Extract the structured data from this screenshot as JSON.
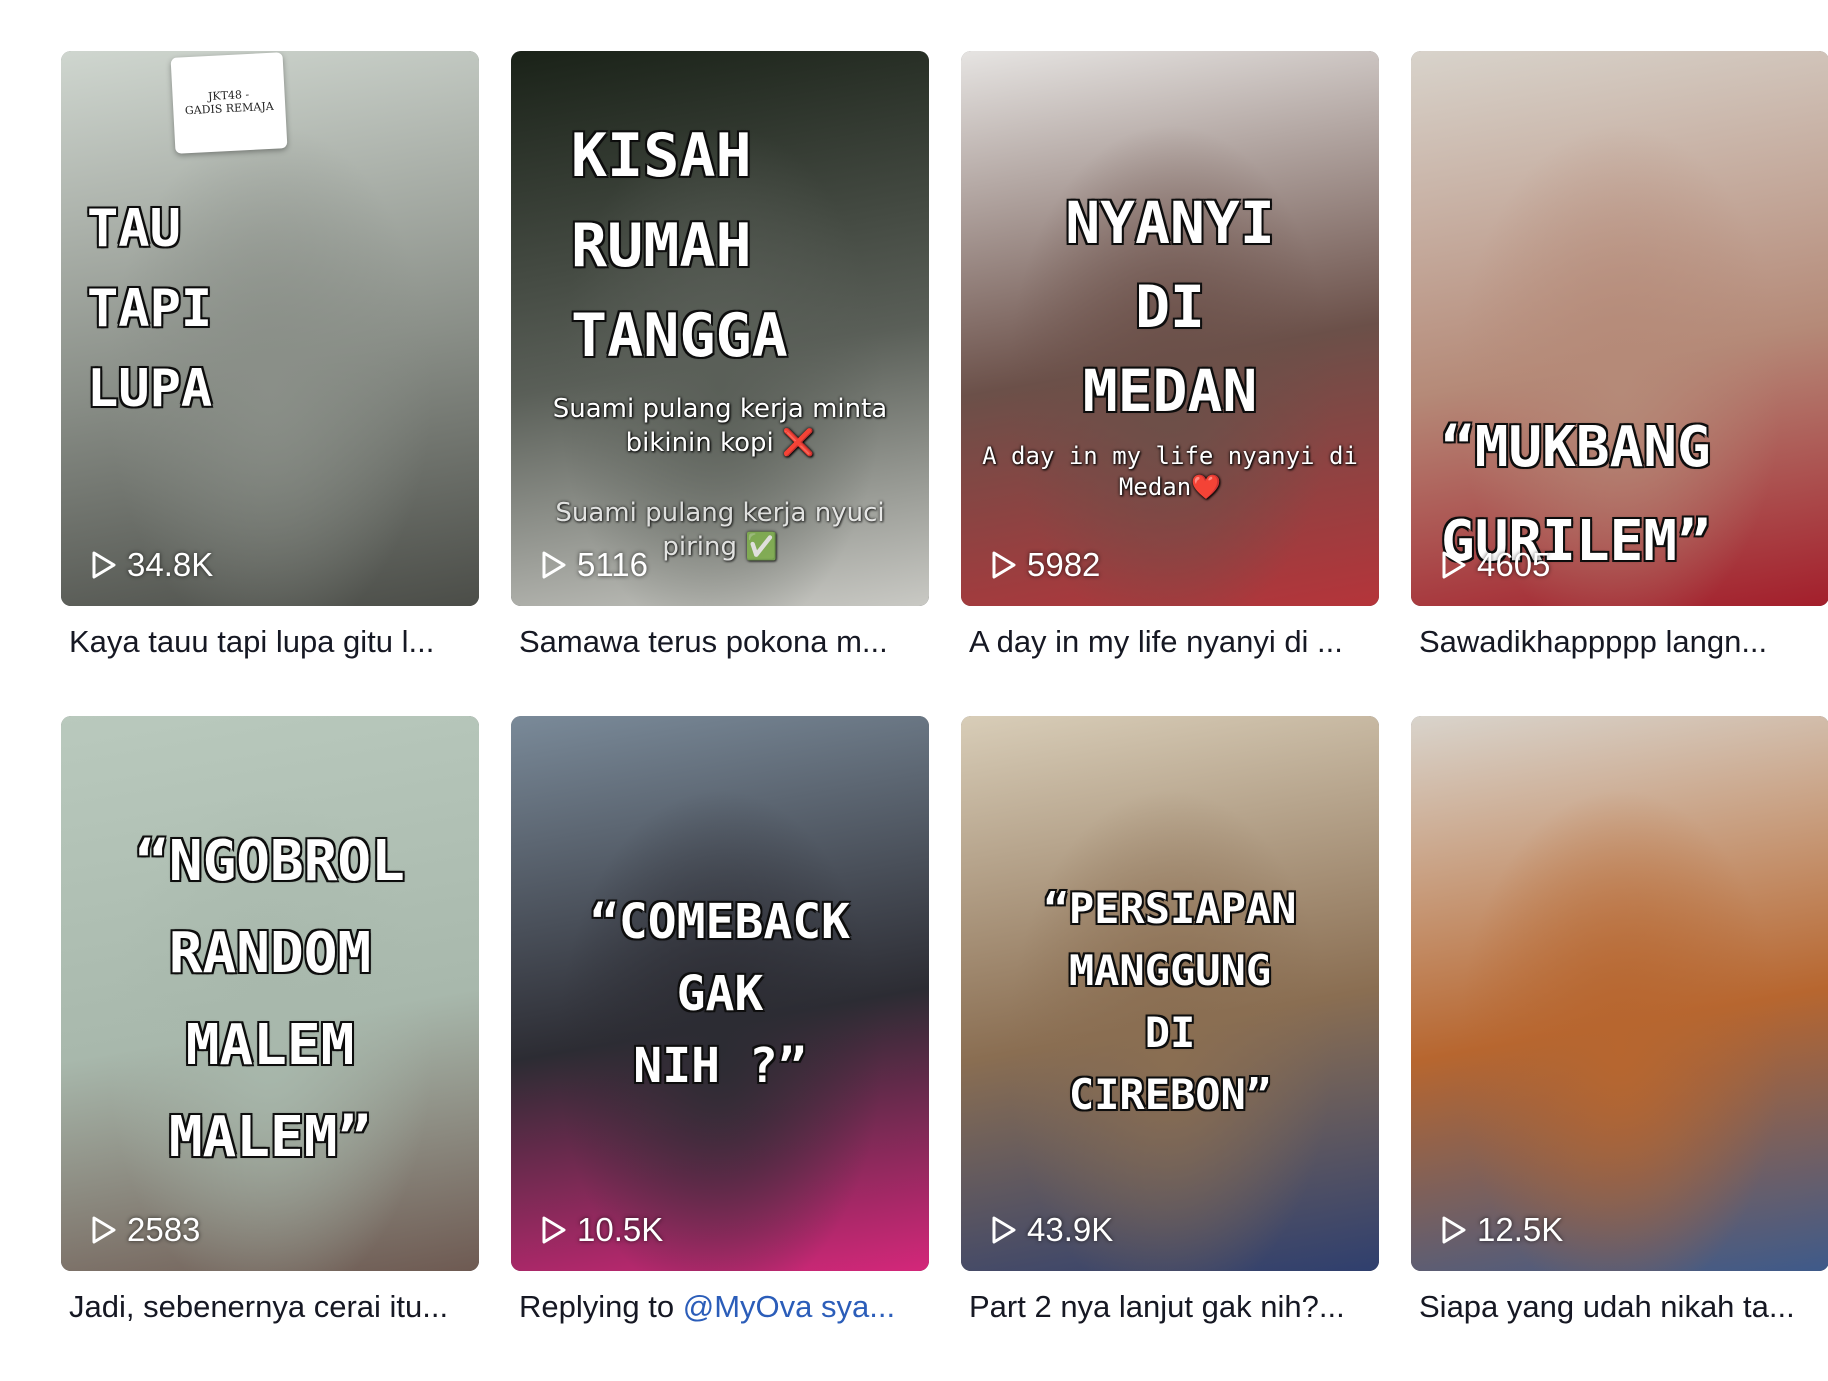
{
  "videos": [
    {
      "overlay": "TAU\nTAPI\nLUPA",
      "subtitle": "",
      "subtitle2": "",
      "mini_card": "JKT48 -\nGADIS REMAJA",
      "views": "34.8K",
      "caption": "Kaya tauu tapi lupa gitu l...",
      "caption_mention": "",
      "colors": [
        "#cfd6cf",
        "#8a8f88",
        "#4b4d48"
      ]
    },
    {
      "overlay": "KISAH\nRUMAH\nTANGGA",
      "subtitle": "Suami pulang kerja minta\nbikinin kopi ❌",
      "subtitle2": "Suami pulang kerja nyuci\npiring ✅",
      "mini_card": "",
      "views": "5116",
      "caption": "Samawa terus pokona m...",
      "caption_mention": "",
      "colors": [
        "#1a2218",
        "#5a5f58",
        "#c9c9c4"
      ]
    },
    {
      "overlay": "NYANYI\nDI\nMEDAN",
      "subtitle": "A day in my life nyanyi di\nMedan❤️",
      "subtitle2": "",
      "mini_card": "",
      "views": "5982",
      "caption": "A day in my life nyanyi di ...",
      "caption_mention": "",
      "colors": [
        "#e6e4e2",
        "#6b5049",
        "#b5343a"
      ]
    },
    {
      "overlay": "“MUKBANG\nGURILEM”",
      "subtitle": "",
      "subtitle2": "",
      "mini_card": "",
      "views": "4605",
      "caption": "Sawadikhappppp langn...",
      "caption_mention": "",
      "colors": [
        "#d8d3cb",
        "#b58a78",
        "#a31e2b"
      ]
    },
    {
      "overlay": "“NGOBROL\nRANDOM\nMALEM\nMALEM”",
      "subtitle": "",
      "subtitle2": "",
      "mini_card": "",
      "views": "2583",
      "caption": "Jadi, sebenernya cerai itu...",
      "caption_mention": "",
      "colors": [
        "#b9c9bd",
        "#a8b8ac",
        "#6e5a52"
      ]
    },
    {
      "overlay": "“COMEBACK\nGAK\nNIH  ?”",
      "subtitle": "",
      "subtitle2": "",
      "mini_card": "",
      "views": "10.5K",
      "caption": "Replying to ",
      "caption_mention": "@MyOva sya...",
      "colors": [
        "#7a8a99",
        "#2c2c33",
        "#d4277a"
      ]
    },
    {
      "overlay": "“PERSIAPAN\nMANGGUNG\nDI\nCIREBON”",
      "subtitle": "",
      "subtitle2": "",
      "mini_card": "",
      "views": "43.9K",
      "caption": "Part 2 nya lanjut gak nih?...",
      "caption_mention": "",
      "colors": [
        "#d8cdb8",
        "#8a6e52",
        "#2f3f6e"
      ]
    },
    {
      "overlay": "",
      "subtitle": "",
      "subtitle2": "",
      "mini_card": "",
      "views": "12.5K",
      "caption": "Siapa yang udah nikah ta...",
      "caption_mention": "",
      "colors": [
        "#d9d4cc",
        "#b7662f",
        "#3e5a8a"
      ]
    }
  ]
}
